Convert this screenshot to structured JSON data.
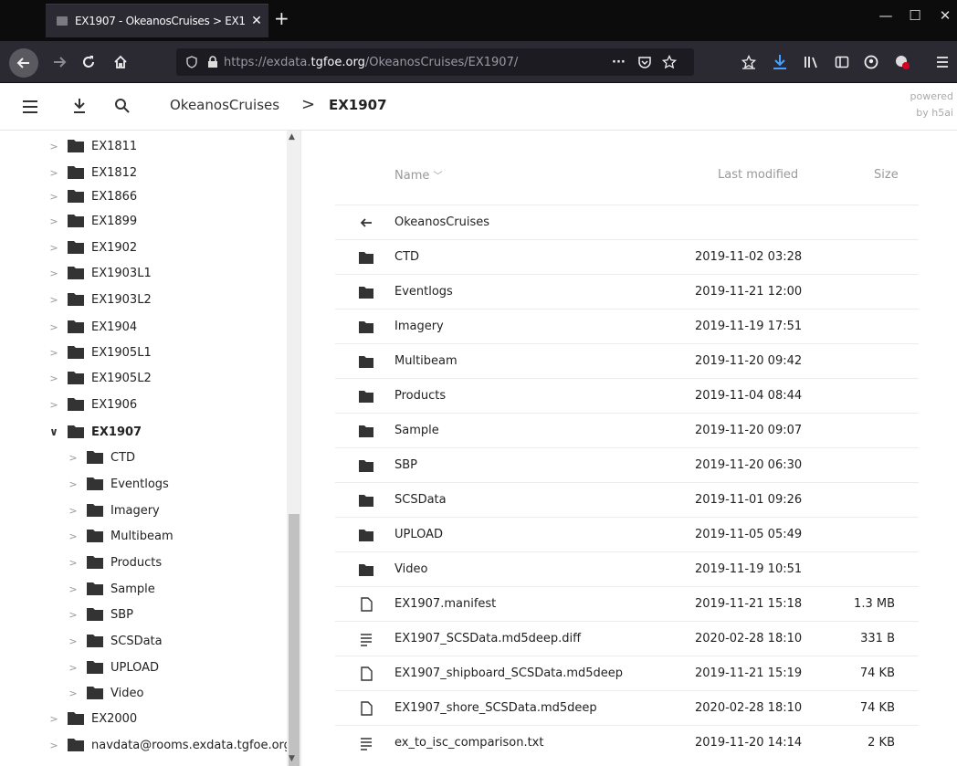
{
  "browser": {
    "tab_title": "EX1907 - OkeanosCruises > EX1",
    "tab_close": "✕",
    "new_tab": "+",
    "url_prefix": "https://",
    "url_domain_pre": "exdata.",
    "url_domain": "tgfoe.org",
    "url_path": "/OkeanosCruises/EX1907/",
    "url_more": "···"
  },
  "header": {
    "crumb_root": "OkeanosCruises",
    "crumb_sep": ">",
    "crumb_current": "EX1907",
    "powered_1": "powered",
    "powered_2": "by h5ai"
  },
  "sidebar": {
    "items": [
      {
        "label": "EX1811",
        "level": 0
      },
      {
        "label": "EX1812",
        "level": 0
      },
      {
        "label": "EX1866",
        "level": 0
      },
      {
        "label": "EX1899",
        "level": 0
      },
      {
        "label": "EX1902",
        "level": 0
      },
      {
        "label": "EX1903L1",
        "level": 0
      },
      {
        "label": "EX1903L2",
        "level": 0
      },
      {
        "label": "EX1904",
        "level": 0
      },
      {
        "label": "EX1905L1",
        "level": 0
      },
      {
        "label": "EX1905L2",
        "level": 0
      },
      {
        "label": "EX1906",
        "level": 0
      },
      {
        "label": "EX1907",
        "level": 0,
        "expanded": true,
        "active": true
      },
      {
        "label": "CTD",
        "level": 1
      },
      {
        "label": "Eventlogs",
        "level": 1
      },
      {
        "label": "Imagery",
        "level": 1
      },
      {
        "label": "Multibeam",
        "level": 1
      },
      {
        "label": "Products",
        "level": 1
      },
      {
        "label": "Sample",
        "level": 1
      },
      {
        "label": "SBP",
        "level": 1
      },
      {
        "label": "SCSData",
        "level": 1
      },
      {
        "label": "UPLOAD",
        "level": 1
      },
      {
        "label": "Video",
        "level": 1
      },
      {
        "label": "EX2000",
        "level": 0
      },
      {
        "label": "navdata@rooms.exdata.tgfoe.org",
        "level": 0
      }
    ]
  },
  "table": {
    "col_name": "Name",
    "col_modified": "Last modified",
    "col_size": "Size",
    "parent": "OkeanosCruises",
    "rows": [
      {
        "name": "CTD",
        "date": "2019-11-02 03:28",
        "size": "",
        "icon": "folder"
      },
      {
        "name": "Eventlogs",
        "date": "2019-11-21 12:00",
        "size": "",
        "icon": "folder"
      },
      {
        "name": "Imagery",
        "date": "2019-11-19 17:51",
        "size": "",
        "icon": "folder"
      },
      {
        "name": "Multibeam",
        "date": "2019-11-20 09:42",
        "size": "",
        "icon": "folder"
      },
      {
        "name": "Products",
        "date": "2019-11-04 08:44",
        "size": "",
        "icon": "folder"
      },
      {
        "name": "Sample",
        "date": "2019-11-20 09:07",
        "size": "",
        "icon": "folder"
      },
      {
        "name": "SBP",
        "date": "2019-11-20 06:30",
        "size": "",
        "icon": "folder"
      },
      {
        "name": "SCSData",
        "date": "2019-11-01 09:26",
        "size": "",
        "icon": "folder"
      },
      {
        "name": "UPLOAD",
        "date": "2019-11-05 05:49",
        "size": "",
        "icon": "folder"
      },
      {
        "name": "Video",
        "date": "2019-11-19 10:51",
        "size": "",
        "icon": "folder"
      },
      {
        "name": "EX1907.manifest",
        "date": "2019-11-21 15:18",
        "size": "1.3 MB",
        "icon": "file"
      },
      {
        "name": "EX1907_SCSData.md5deep.diff",
        "date": "2020-02-28 18:10",
        "size": "331 B",
        "icon": "text"
      },
      {
        "name": "EX1907_shipboard_SCSData.md5deep",
        "date": "2019-11-21 15:19",
        "size": "74 KB",
        "icon": "file"
      },
      {
        "name": "EX1907_shore_SCSData.md5deep",
        "date": "2020-02-28 18:10",
        "size": "74 KB",
        "icon": "file"
      },
      {
        "name": "ex_to_isc_comparison.txt",
        "date": "2019-11-20 14:14",
        "size": "2 KB",
        "icon": "text"
      }
    ]
  }
}
